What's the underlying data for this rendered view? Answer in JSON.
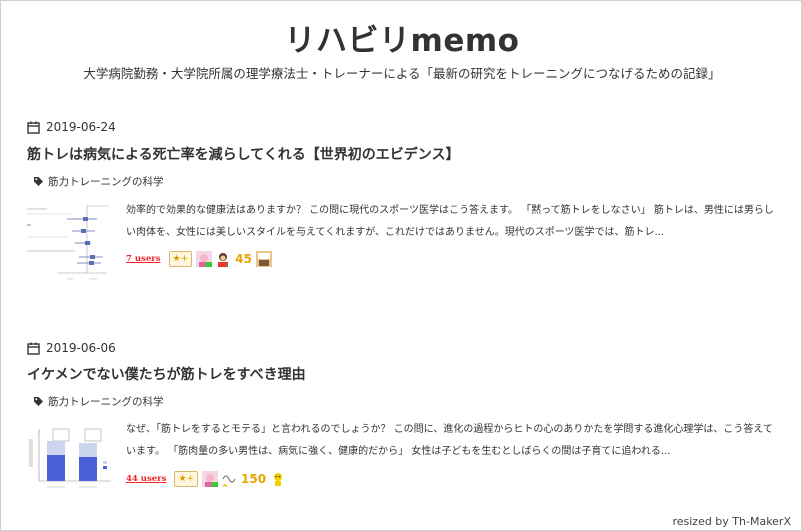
{
  "header": {
    "title": "リハビリmemo",
    "description": "大学病院勤務・大学院所属の理学療法士・トレーナーによる「最新の研究をトレーニングにつなげるための記録」"
  },
  "posts": [
    {
      "date": "2019-06-24",
      "title": "筋トレは病気による死亡率を減らしてくれる【世界初のエビデンス】",
      "tag": "筋力トレーニングの科学",
      "excerpt": "効率的で効果的な健康法はありますか？ この問に現代のスポーツ医学はこう答えます。 「黙って筋トレをしなさい」 筋トレは、男性には男らしい肉体を、女性には美しいスタイルを与えてくれますが、これだけではありません。現代のスポーツ医学では、筋トレ...",
      "users": "7 users",
      "star_count": "45",
      "thumb_icon": "forest-plot-thumbnail"
    },
    {
      "date": "2019-06-06",
      "title": "イケメンでない僕たちが筋トレをすべき理由",
      "tag": "筋力トレーニングの科学",
      "excerpt": "なぜ、「筋トレをするとモテる」と言われるのでしょうか？ この問に、進化の過程からヒトの心のありかたを学問する進化心理学は、こう答えています。 「筋肉量の多い男性は、病気に強く、健康的だから」 女性は子どもを生むとしばらくの間は子育てに追われる...",
      "users": "44 users",
      "star_count": "150",
      "thumb_icon": "bar-chart-thumbnail"
    }
  ],
  "star_add_label": "★+",
  "footer": {
    "credit": "resized by Th-MakerX"
  },
  "colors": {
    "users": "#e22222",
    "stars": "#e8a500"
  }
}
